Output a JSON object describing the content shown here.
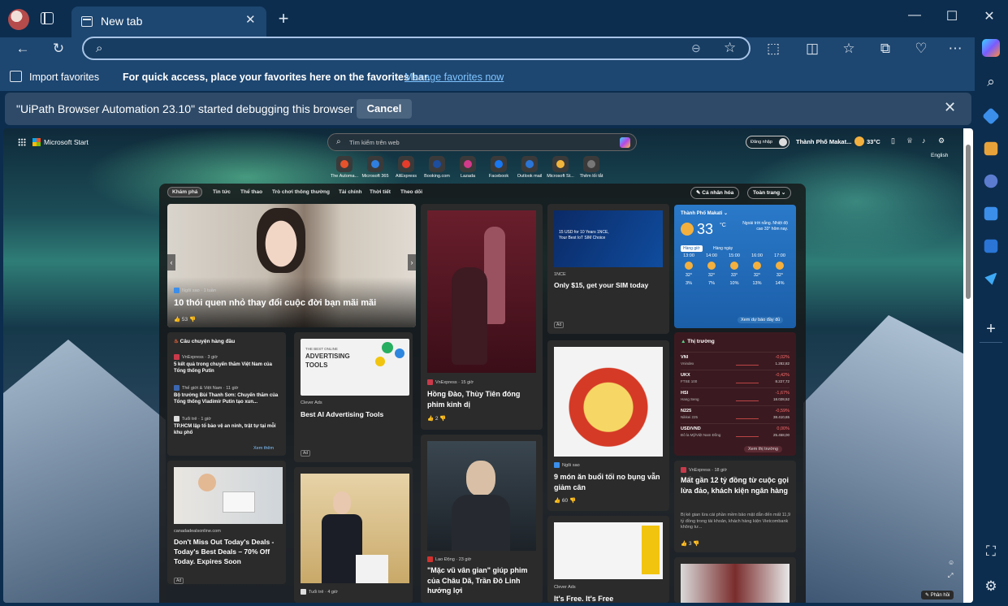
{
  "browser": {
    "tab_title": "New tab",
    "tab_close": "✕",
    "new_tab": "+",
    "window_min": "—",
    "window_max": "☐",
    "window_close": "✕",
    "address_value": "",
    "favorites": {
      "import_label": "Import favorites",
      "message": "For quick access, place your favorites here on the favorites bar.",
      "manage_link": "Manage favorites now"
    },
    "infobar": {
      "text": "\"UiPath Browser Automation 23.10\" started debugging this browser",
      "cancel_label": "Cancel",
      "close": "✕"
    },
    "sidebar_colors": [
      "#3b8eea",
      "#e8a23a",
      "#5b7ccf",
      "#3b8eea",
      "#4a9fe8",
      "#3fa9f5"
    ]
  },
  "ms_start": {
    "brand": "Microsoft Start",
    "search_placeholder": "Tìm kiếm trên web",
    "quick_links": [
      {
        "label": "The Automa...",
        "color": "#e4532c"
      },
      {
        "label": "Microsoft 365",
        "color": "#2f7fe0"
      },
      {
        "label": "AliExpress",
        "color": "#e63c2b"
      },
      {
        "label": "Booking.com",
        "color": "#1d4d9d"
      },
      {
        "label": "Lazada",
        "color": "#d33a8a"
      },
      {
        "label": "Facebook",
        "color": "#1877f2"
      },
      {
        "label": "Outlook mail",
        "color": "#2a75d6"
      },
      {
        "label": "Microsoft St...",
        "color": "#f2b53c"
      },
      {
        "label": "Thêm lối tắt",
        "color": "#777777"
      }
    ],
    "signin_label": "Đăng nhập",
    "location": "Thành Phố Makat...",
    "temp": "33°C",
    "language": "English",
    "nav_tabs": [
      "Khám phá",
      "Tin tức",
      "Thể thao",
      "Trò chơi thông thường",
      "Tài chính",
      "Thời tiết",
      "Theo dõi"
    ],
    "personalize_label": "Cá nhân hóa",
    "fullpage_label": "Toàn trang"
  },
  "cards": {
    "hero": {
      "source": "Ngôi sao · 1 tuần",
      "title": "10 thói quen nhỏ thay đổi cuộc đời bạn mãi mãi",
      "likes": "53"
    },
    "top_stories": {
      "header": "Câu chuyện hàng đầu",
      "items": [
        {
          "source": "VnExpress · 3 giờ",
          "title": "5 kết quả trong chuyến thăm Việt Nam của Tổng thống Putin"
        },
        {
          "source": "Thế giới & Việt Nam · 11 giờ",
          "title": "Bộ trưởng Bùi Thanh Sơn: Chuyến thăm của Tổng thống Vladimir Putin tạo xun..."
        },
        {
          "source": "Tuổi trẻ · 1 giờ",
          "title": "TP.HCM lập tổ bảo vệ an ninh, trật tự tại mỗi khu phố"
        }
      ],
      "more": "Xem thêm"
    },
    "ad_tools": {
      "image_line1": "THE BEST ONLINE",
      "image_line2": "ADVERTISING",
      "image_line3": "TOOLS",
      "source": "Clever Ads",
      "title": "Best AI Advertising Tools",
      "ad": "Ad"
    },
    "dress": {
      "source": "VnExpress · 15 giờ",
      "title": "Hồng Đào, Thùy Tiên đóng phim kinh dị",
      "likes": "2"
    },
    "sim_ad": {
      "image_text": "15 USD for 10 Years 1NCE, Your Best IoT SIM Choice",
      "source": "1NCE",
      "title": "Only $15, get your SIM today",
      "ad": "Ad"
    },
    "food": {
      "source": "Ngôi sao",
      "title": "9 món ăn buổi tối no bụng vẫn giảm cân",
      "likes": "60"
    },
    "weather": {
      "city": "Thành Phố Makati",
      "temp": "33",
      "unit": "°C",
      "note": "Ngoài trời nắng. Nhiệt độ cao 33° hôm nay.",
      "tab_hourly": "Hàng giờ",
      "tab_daily": "Hàng ngày",
      "hours": [
        {
          "time": "13:00",
          "temp": "32°",
          "rain": "3%"
        },
        {
          "time": "14:00",
          "temp": "32°",
          "rain": "7%"
        },
        {
          "time": "15:00",
          "temp": "33°",
          "rain": "10%"
        },
        {
          "time": "16:00",
          "temp": "32°",
          "rain": "13%"
        },
        {
          "time": "17:00",
          "temp": "32°",
          "rain": "14%"
        }
      ],
      "full_forecast": "Xem dự báo đầy đủ"
    },
    "market": {
      "header": "Thị trường",
      "rows": [
        {
          "name": "VNI",
          "sub": "Vnindex",
          "change": "-0,02%",
          "value": "1.282,82"
        },
        {
          "name": "UKX",
          "sub": "FTSE 100",
          "change": "-0,42%",
          "value": "8.227,72"
        },
        {
          "name": "HSI",
          "sub": "Hang Seng",
          "change": "-1,67%",
          "value": "18.028,52"
        },
        {
          "name": "N225",
          "sub": "Nikkei 225",
          "change": "-0,59%",
          "value": "38.410,65"
        },
        {
          "name": "USD/VND",
          "sub": "Đô la Mỹ/Việt Nam Đồng",
          "change": "0,00%",
          "value": "25.458,00"
        }
      ],
      "more": "Xem thị trường"
    },
    "lottery": {
      "source": "VnExpress · 18 giờ",
      "title": "Mất gần 12 tỷ đồng từ cuộc gọi lừa đảo, khách kiện ngân hàng",
      "summary": "Bị kẻ gian lừa cài phần mềm bảo mật dẫn đến mất 11,9 tỷ đồng trong tài khoản, khách hàng kiện Vietcombank không tư...",
      "likes": "3"
    },
    "deals": {
      "source": "canadadealsonline.com",
      "title": "Don't Miss Out Today's Deals - Today's Best Deals – 70% Off Today. Expires Soon",
      "ad": "Ad"
    },
    "putin": {
      "source": "Tuổi trẻ · 4 giờ"
    },
    "drama": {
      "source": "Lao Động · 23 giờ",
      "title": "\"Mặc vũ vân gian\" giúp phim của Châu Dã, Trần Đô Linh hưởng lợi"
    },
    "clever2": {
      "source": "Clever Ads",
      "title": "It's Free. It's Free"
    }
  },
  "feedback": "Phản hồi"
}
